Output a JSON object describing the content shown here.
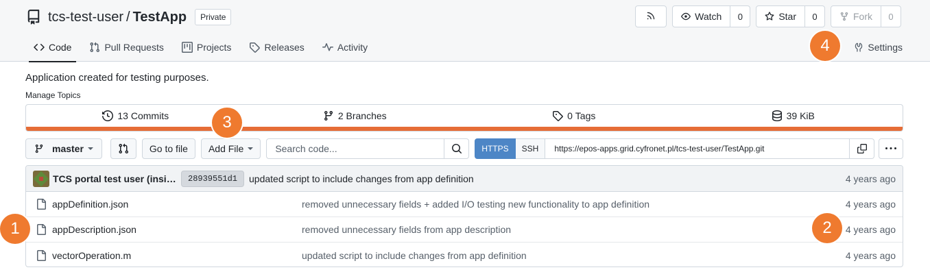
{
  "repo": {
    "owner": "tcs-test-user",
    "separator": "/",
    "name": "TestApp",
    "visibility": "Private",
    "icon": "repo-icon"
  },
  "actions": {
    "watch": {
      "label": "Watch",
      "count": "0"
    },
    "star": {
      "label": "Star",
      "count": "0"
    },
    "fork": {
      "label": "Fork",
      "count": "0"
    }
  },
  "tabs": [
    {
      "label": "Code",
      "icon": "code-icon"
    },
    {
      "label": "Pull Requests",
      "icon": "pull-request-icon"
    },
    {
      "label": "Projects",
      "icon": "project-icon"
    },
    {
      "label": "Releases",
      "icon": "tag-icon"
    },
    {
      "label": "Activity",
      "icon": "pulse-icon"
    }
  ],
  "settings_label": "Settings",
  "description": "Application created for testing purposes.",
  "manage_topics": "Manage Topics",
  "stats": {
    "commits": {
      "count": "13",
      "label": "Commits"
    },
    "branches": {
      "count": "2",
      "label": "Branches"
    },
    "tags": {
      "count": "0",
      "label": "Tags"
    },
    "size": {
      "count": "39 KiB"
    }
  },
  "toolbar": {
    "branch": "master",
    "go_to_file": "Go to file",
    "add_file": "Add File",
    "search_placeholder": "Search code...",
    "https": "HTTPS",
    "ssh": "SSH",
    "clone_url": "https://epos-apps.grid.cyfronet.pl/tcs-test-user/TestApp.git"
  },
  "latest_commit": {
    "author": "TCS portal test user (insilic...",
    "sha": "28939551d1",
    "message": "updated script to include changes from app definition",
    "time": "4 years ago"
  },
  "files": [
    {
      "name": "appDefinition.json",
      "message": "removed unnecessary fields + added I/O testing new functionality to app definition",
      "time": "4 years ago"
    },
    {
      "name": "appDescription.json",
      "message": "removed unnecessary fields from app description",
      "time": "4 years ago"
    },
    {
      "name": "vectorOperation.m",
      "message": "updated script to include changes from app definition",
      "time": "4 years ago"
    }
  ],
  "markers": [
    "1",
    "2",
    "3",
    "4"
  ],
  "colors": {
    "accent": "#e66d37",
    "marker": "#ef7a2f",
    "https_active": "#4d86c6"
  }
}
